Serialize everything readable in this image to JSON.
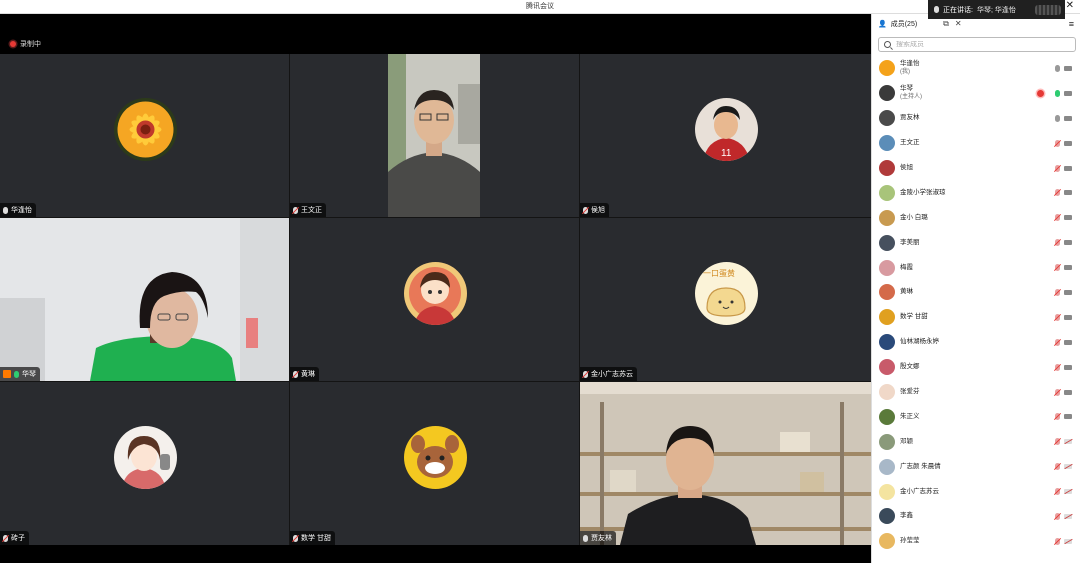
{
  "window": {
    "title": "腾讯会议"
  },
  "speaking": {
    "label": "正在讲话:",
    "names": "华琴; 华逢怡"
  },
  "recording": {
    "label": "录制中"
  },
  "tiles": [
    {
      "name": "华逢怡",
      "mic": "on"
    },
    {
      "name": "王文正",
      "mic": "muted"
    },
    {
      "name": "侯旭",
      "mic": "muted"
    },
    {
      "name": "华琴",
      "mic": "on",
      "host": true,
      "active": true
    },
    {
      "name": "黄琳",
      "mic": "muted"
    },
    {
      "name": "金小广志苏云",
      "mic": "muted"
    },
    {
      "name": "砖子",
      "mic": "muted"
    },
    {
      "name": "数学 甘甜",
      "mic": "muted"
    },
    {
      "name": "贾友林",
      "mic": "on"
    }
  ],
  "panel": {
    "title": "成员(25)",
    "search_placeholder": "搜索成员",
    "members": [
      {
        "name": "华逢怡",
        "role": "(我)",
        "mic": "on",
        "cam": "on",
        "color": "#f4a21a"
      },
      {
        "name": "华琴",
        "role": "(主持人)",
        "mic": "on",
        "cam": "on",
        "rec": true,
        "color": "#3a3a3a"
      },
      {
        "name": "贾友林",
        "mic": "on",
        "cam": "on",
        "color": "#4a4a4a"
      },
      {
        "name": "王文正",
        "mic": "muted",
        "cam": "on",
        "color": "#5b8db8"
      },
      {
        "name": "侯旭",
        "mic": "muted",
        "cam": "on",
        "color": "#b03a3a"
      },
      {
        "name": "金陵小学张淑琼",
        "mic": "muted",
        "cam": "on",
        "color": "#a8c47a"
      },
      {
        "name": "金小 白璐",
        "mic": "muted",
        "cam": "on",
        "color": "#c89a50"
      },
      {
        "name": "李美丽",
        "mic": "muted",
        "cam": "on",
        "color": "#46505e"
      },
      {
        "name": "梅霞",
        "mic": "muted",
        "cam": "on",
        "color": "#d89aa0"
      },
      {
        "name": "黄琳",
        "mic": "muted",
        "cam": "on",
        "color": "#d46a4a"
      },
      {
        "name": "数学 甘甜",
        "mic": "muted",
        "cam": "on",
        "color": "#e0a020"
      },
      {
        "name": "仙林湖杨永婷",
        "mic": "muted",
        "cam": "on",
        "color": "#2a4a7a"
      },
      {
        "name": "殷文娜",
        "mic": "muted",
        "cam": "on",
        "color": "#c85a6a"
      },
      {
        "name": "张爱芬",
        "mic": "muted",
        "cam": "on",
        "color": "#f0d8c8"
      },
      {
        "name": "朱正义",
        "mic": "muted",
        "cam": "on",
        "color": "#5a7a3a"
      },
      {
        "name": "邓颖",
        "mic": "muted",
        "cam": "off",
        "color": "#8a9a7a"
      },
      {
        "name": "广志颜 朱晨倩",
        "mic": "muted",
        "cam": "off",
        "color": "#a8b8c8"
      },
      {
        "name": "金小广志苏云",
        "mic": "muted",
        "cam": "off",
        "color": "#f4e4a0"
      },
      {
        "name": "李鑫",
        "mic": "muted",
        "cam": "off",
        "color": "#3a4a5a"
      },
      {
        "name": "孙莹莹",
        "mic": "muted",
        "cam": "off",
        "color": "#e8b860"
      }
    ]
  }
}
